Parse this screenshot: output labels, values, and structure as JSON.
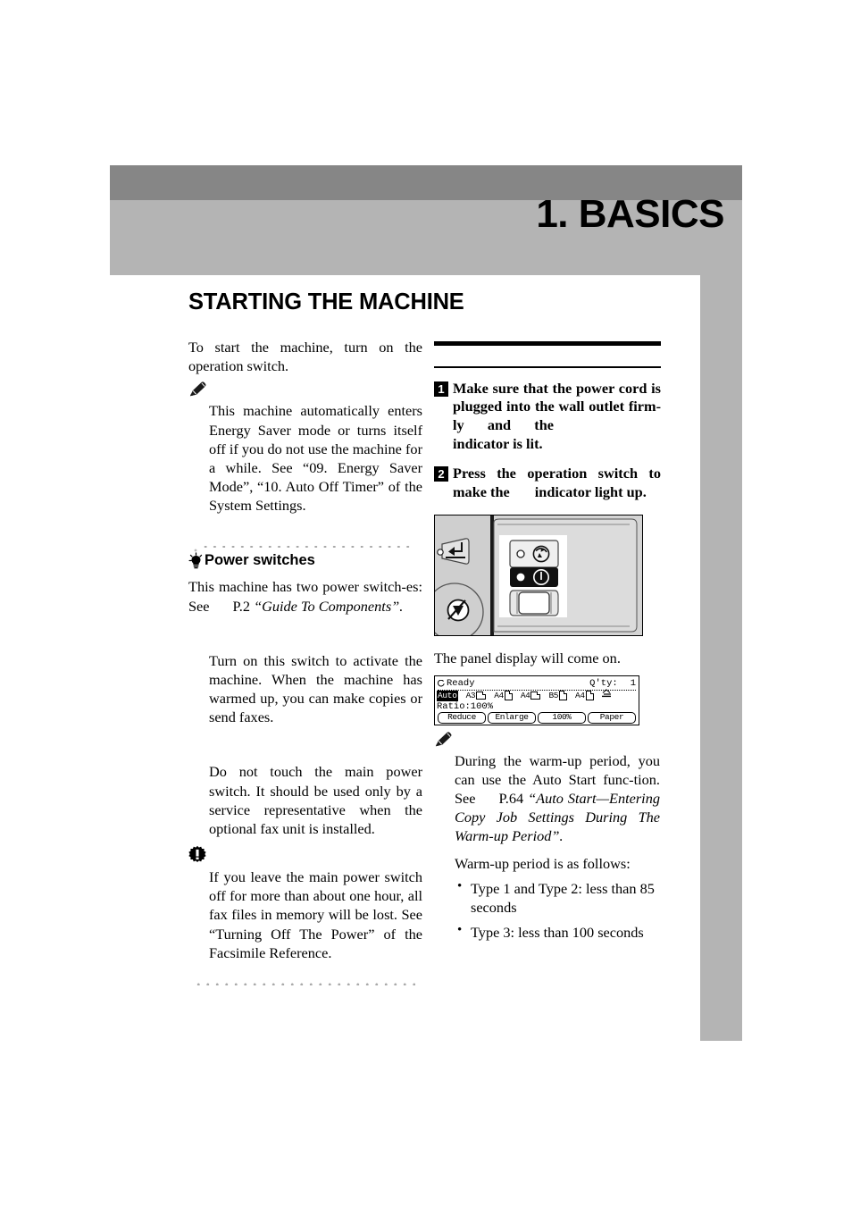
{
  "chapter": {
    "title": "1. BASICS"
  },
  "section": {
    "title": "STARTING THE MACHINE"
  },
  "left_column": {
    "lead": "To start the machine, turn on the operation switch.",
    "note_icon": "pencil-note-icon",
    "note_text": "This machine automatically enters Energy Saver mode or turns itself off if you do not use the machine for a while. See “09. Energy Saver Mode”, “10. Auto  Off Timer” of the System Settings.",
    "subsection": {
      "icon": "lightbulb-icon",
      "heading": "Power switches",
      "intro_before_ref": "This machine has two power switch-es: See",
      "ref_page": "P.2",
      "ref_title": "“Guide To Components”.",
      "item_operation": "Turn on this switch to activate the machine. When the machine has warmed up, you can make copies or send faxes.",
      "item_main": "Do not touch the main power switch. It should be used only by a service representative when the optional fax unit is installed."
    },
    "important_icon": "important-starburst-icon",
    "important_text": "If you leave the main power switch off for more than about one hour, all fax files in memory will be lost. See “Turning Off The Power” of the Facsimile Reference."
  },
  "right_column": {
    "steps": [
      {
        "number": "1",
        "text_a": "Make sure that the power cord is plugged into the wall outlet firm-ly and the",
        "text_b": "indicator is lit."
      },
      {
        "number": "2",
        "text_a": "Press  the   operation  switch  to make the",
        "text_b": "indicator light up."
      }
    ],
    "illustration": {
      "name": "operation-panel-photo",
      "alt": "Copier operation panel with main power switch and operation switch"
    },
    "caption": "The panel display will come on.",
    "lcd": {
      "status": "Ready",
      "qty_label": "Q'ty:",
      "qty_value": "1",
      "auto_chip": "Auto",
      "trays": [
        {
          "label": "A3",
          "orient": "landscape"
        },
        {
          "label": "A4",
          "orient": "portrait"
        },
        {
          "label": "A4",
          "orient": "landscape"
        },
        {
          "label": "B5",
          "orient": "portrait"
        },
        {
          "label": "A4",
          "orient": "portrait"
        }
      ],
      "bypass_icon": "bypass-tray-icon",
      "ratio": "Ratio:100%",
      "buttons": [
        "Reduce",
        "Enlarge",
        "100%",
        "Paper"
      ]
    },
    "note_icon": "pencil-note-icon",
    "note_text_a": "During  the  warm-up  period, you can use the Auto Start func-tion. See",
    "note_ref_page": "P.64",
    "note_ref_title": "“Auto Start—Entering Copy Job Settings During The Warm-up Period”.",
    "warmup_intro": "Warm-up period is as follows:",
    "warmup_items": [
      "Type 1 and Type 2: less than 85 seconds",
      "Type 3: less than 100 seconds"
    ]
  },
  "colors": {
    "banner_dark": "#868686",
    "banner_light": "#b4b4b4",
    "text": "#000000"
  }
}
